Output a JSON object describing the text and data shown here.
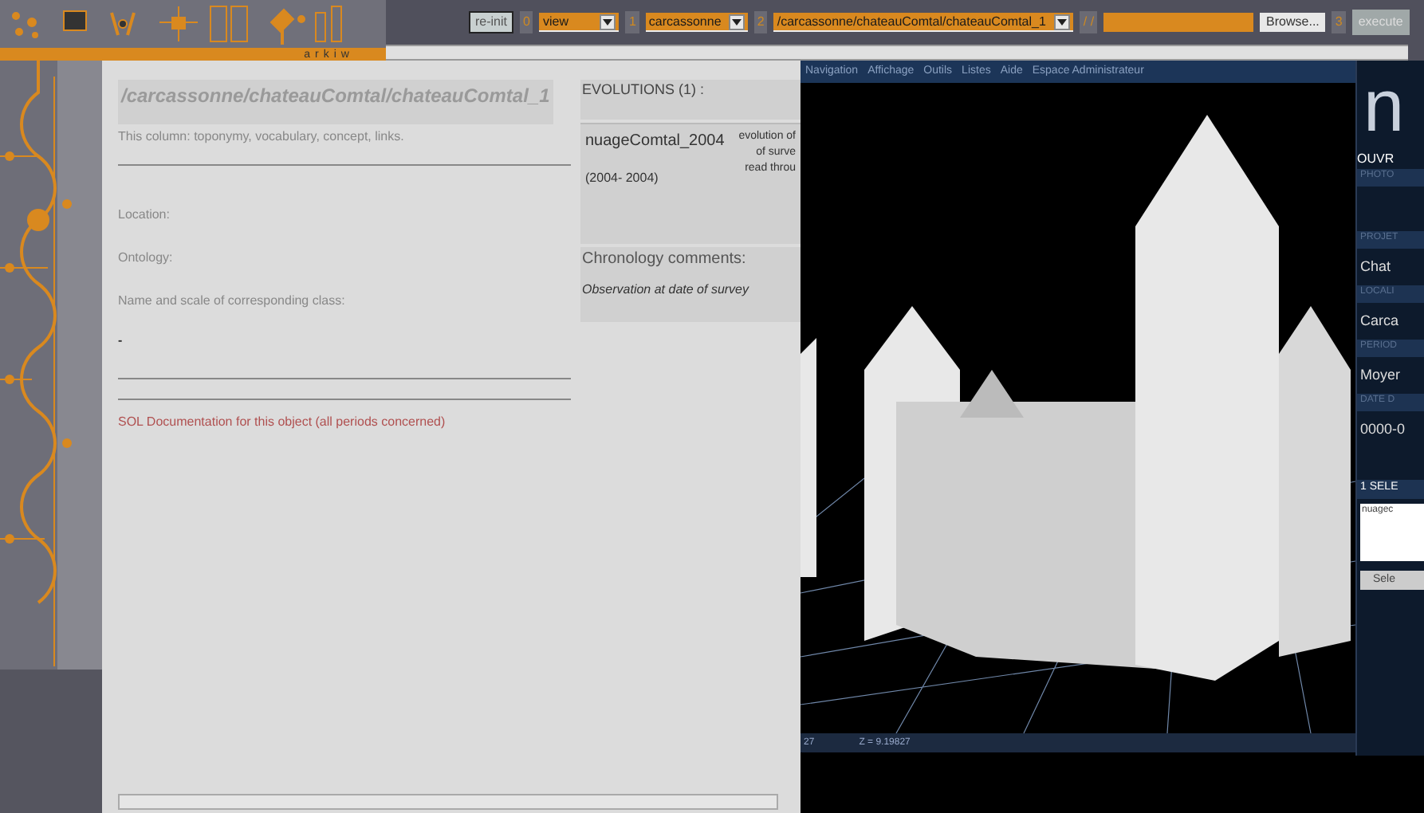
{
  "logo": {
    "text": "arkiw"
  },
  "toolbar": {
    "reset_button": "re-init",
    "steps": [
      "0",
      "1",
      "2",
      "/ /",
      "3"
    ],
    "selects": [
      {
        "value": "view"
      },
      {
        "value": "carcassonne"
      },
      {
        "value": "/carcassonne/chateauComtal/chateauComtal_1"
      }
    ],
    "browse_button": "Browse...",
    "execute_button": "execute"
  },
  "object": {
    "title": "/carcassonne/chateauComtal/chateauComtal_1",
    "note": "This column: toponymy, vocabulary, concept, links.",
    "fields": [
      "Location:",
      "Ontology:",
      "Name and scale of corresponding class:"
    ],
    "value": "-",
    "link": "SOL Documentation for this object (all periods concerned)"
  },
  "evolutions": {
    "heading": "EVOLUTIONS (1) :",
    "items": [
      {
        "name": "nuageComtal_2004",
        "dates": "(2004- 2004)",
        "description": [
          "evolution of",
          "of surve",
          "read throu"
        ]
      }
    ],
    "chronology_heading": "Chronology comments:",
    "chronology_text": "Observation at date of survey"
  },
  "viewer": {
    "menu": [
      "Navigation",
      "Affichage",
      "Outils",
      "Listes",
      "Aide",
      "Espace Administrateur"
    ],
    "status": [
      "27",
      "Z = 9.19827"
    ]
  },
  "side_panel": {
    "logo": "n",
    "title": "OUVR",
    "fields": [
      {
        "label": "PHOTO"
      },
      {
        "label": "PROJET",
        "value": "Chat"
      },
      {
        "label": "LOCALI",
        "value": "Carca"
      },
      {
        "label": "PERIOD",
        "value": "Moyer"
      },
      {
        "label": "DATE D",
        "value": "0000-0"
      }
    ],
    "selection_heading": "1 SELE",
    "selection_item": "nuagec",
    "select_button": "Sele"
  }
}
